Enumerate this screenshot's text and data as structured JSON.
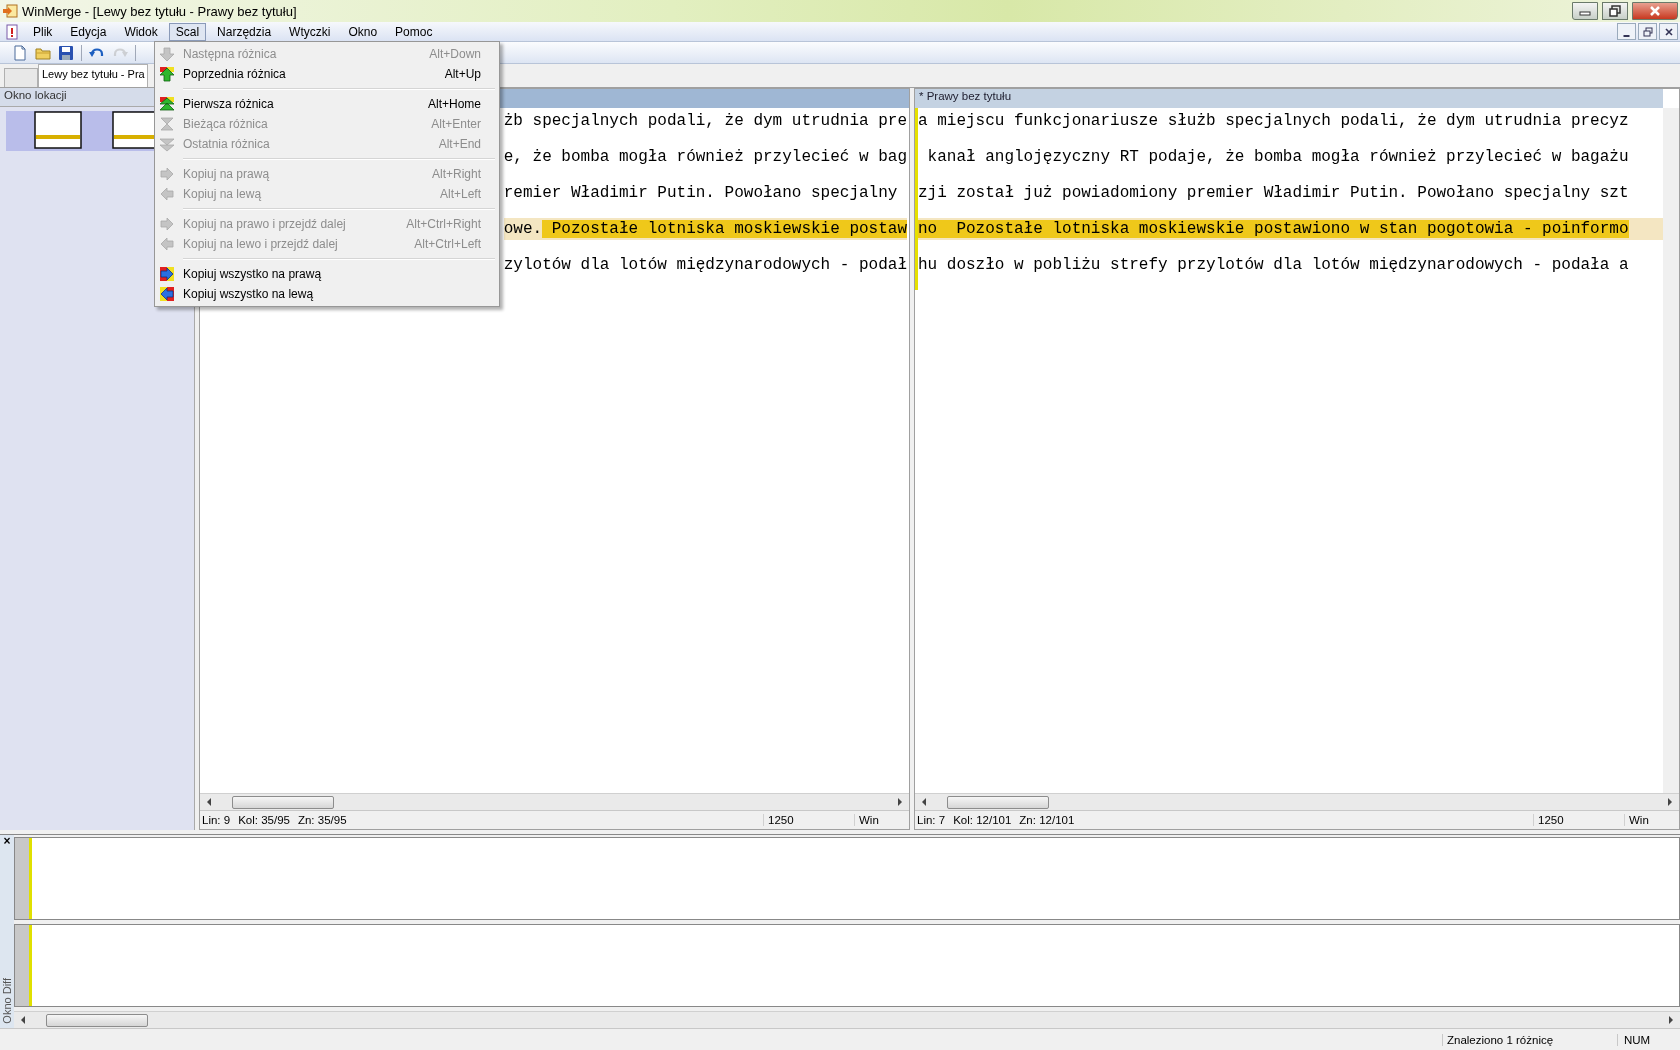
{
  "window": {
    "title": "WinMerge - [Lewy bez tytułu - Prawy bez tytułu]"
  },
  "menu_bar": [
    {
      "label": "Plik",
      "selected": false
    },
    {
      "label": "Edycja",
      "selected": false
    },
    {
      "label": "Widok",
      "selected": false
    },
    {
      "label": "Scal",
      "selected": true
    },
    {
      "label": "Narzędzia",
      "selected": false
    },
    {
      "label": "Wtyczki",
      "selected": false
    },
    {
      "label": "Okno",
      "selected": false
    },
    {
      "label": "Pomoc",
      "selected": false
    }
  ],
  "toolbar": [
    {
      "kind": "new",
      "disabled": false
    },
    {
      "kind": "open",
      "disabled": false
    },
    {
      "kind": "save",
      "disabled": false
    },
    {
      "kind": "undo",
      "disabled": false
    },
    {
      "kind": "redo",
      "disabled": true
    }
  ],
  "tabs": [
    {
      "label": "Lewy bez tytułu - Pra",
      "selected": true
    }
  ],
  "location_pane": {
    "title": "Okno lokacji"
  },
  "left_pane": {
    "lines": [
      {
        "changed": false,
        "segments": [
          {
            "text": "żb specjalnych podali, że dym utrudnia pre",
            "diff": false
          }
        ]
      },
      {
        "changed": false,
        "segments": [
          {
            "text": "e, że bomba mogła również przylecieć w bag",
            "diff": false
          }
        ]
      },
      {
        "changed": false,
        "segments": [
          {
            "text": "remier Władimir Putin. Powołano specjalny ",
            "diff": false
          }
        ]
      },
      {
        "changed": true,
        "segments": [
          {
            "text": "owe.",
            "diff": false
          },
          {
            "text": " Pozostałe lotniska moskiewskie postaw",
            "diff": true
          }
        ]
      },
      {
        "changed": false,
        "segments": [
          {
            "text": "zylotów dla lotów międzynarodowych - podał",
            "diff": false
          }
        ]
      }
    ]
  },
  "right_pane": {
    "title": "* Prawy bez tytułu",
    "lines": [
      {
        "changed": false,
        "segments": [
          {
            "text": "a miejscu funkcjonariusze służb specjalnych podali, że dym utrudnia precyz",
            "diff": false
          }
        ]
      },
      {
        "changed": false,
        "segments": [
          {
            "text": " kanał anglojęzyczny RT podaje, że bomba mogła również przylecieć w bagażu",
            "diff": false
          }
        ]
      },
      {
        "changed": false,
        "segments": [
          {
            "text": "zji został już powiadomiony premier Władimir Putin. Powołano specjalny szt",
            "diff": false
          }
        ]
      },
      {
        "changed": true,
        "segments": [
          {
            "text": "no  Pozostałe lotniska moskiewskie postawiono w stan pogotowia - poinformo",
            "diff": true
          }
        ]
      },
      {
        "changed": false,
        "segments": [
          {
            "text": "hu doszło w pobliżu strefy przylotów dla lotów międzynarodowych - podała a",
            "diff": false
          }
        ]
      }
    ]
  },
  "left_status": {
    "fields": [
      "Lin: 9",
      "Kol: 35/95",
      "Zn: 35/95"
    ],
    "codepage": "1250",
    "eol": "Win"
  },
  "right_status": {
    "fields": [
      "Lin: 7",
      "Kol: 12/101",
      "Zn: 12/101"
    ],
    "codepage": "1250",
    "eol": "Win"
  },
  "merge_menu": {
    "items": [
      {
        "kind": "item",
        "label": "Następna różnica",
        "shortcut": "Alt+Down",
        "disabled": true
      },
      {
        "kind": "item",
        "label": "Poprzednia różnica",
        "shortcut": "Alt+Up",
        "disabled": false
      },
      {
        "kind": "separator"
      },
      {
        "kind": "item",
        "label": "Pierwsza różnica",
        "shortcut": "Alt+Home",
        "disabled": false
      },
      {
        "kind": "item",
        "label": "Bieżąca różnica",
        "shortcut": "Alt+Enter",
        "disabled": true
      },
      {
        "kind": "item",
        "label": "Ostatnia różnica",
        "shortcut": "Alt+End",
        "disabled": true
      },
      {
        "kind": "separator"
      },
      {
        "kind": "item",
        "label": "Kopiuj na prawą",
        "shortcut": "Alt+Right",
        "disabled": true
      },
      {
        "kind": "item",
        "label": "Kopiuj na lewą",
        "shortcut": "Alt+Left",
        "disabled": true
      },
      {
        "kind": "separator"
      },
      {
        "kind": "item",
        "label": "Kopiuj na prawo i przejdź dalej",
        "shortcut": "Alt+Ctrl+Right",
        "disabled": true
      },
      {
        "kind": "item",
        "label": "Kopiuj na lewo i przejdź dalej",
        "shortcut": "Alt+Ctrl+Left",
        "disabled": true
      },
      {
        "kind": "separator"
      },
      {
        "kind": "item",
        "label": "Kopiuj wszystko na prawą",
        "disabled": false
      },
      {
        "kind": "item",
        "label": "Kopiuj wszystko na lewą",
        "disabled": false
      }
    ]
  },
  "diff_pane": {
    "title": "Okno Diff",
    "close": "×"
  },
  "status_bar": {
    "message": "Znaleziono 1 różnicę",
    "indicator": "NUM"
  }
}
